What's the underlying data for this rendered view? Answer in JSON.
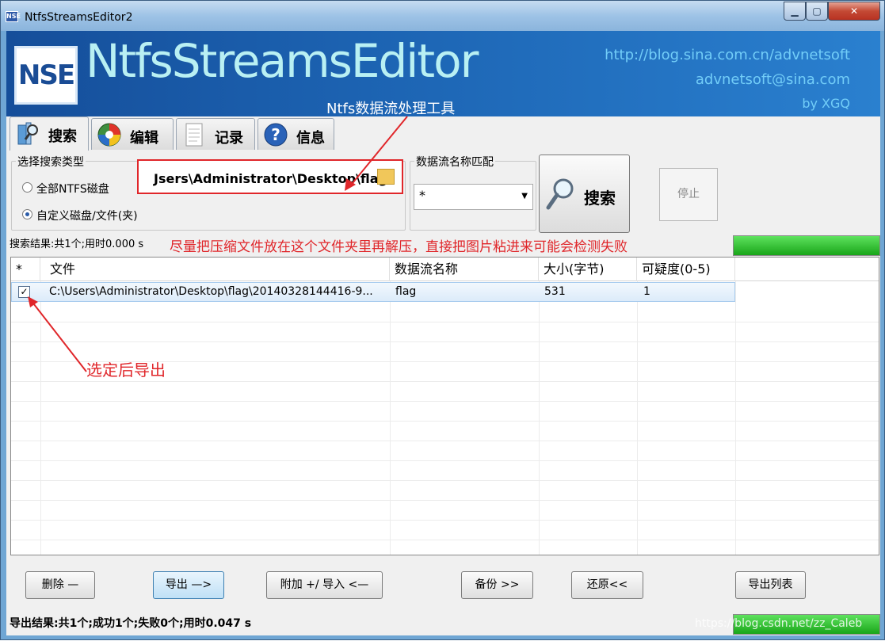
{
  "window": {
    "title": "NtfsStreamsEditor2",
    "app_icon": "NSE",
    "min": "▁",
    "max": "▢",
    "close": "✕"
  },
  "banner": {
    "logo": "NSE",
    "title": "NtfsStreamsEditor",
    "subtitle": "Ntfs数据流处理工具",
    "url": "http://blog.sina.com.cn/advnetsoft",
    "email": "advnetsoft@sina.com",
    "author": "by XGQ"
  },
  "tabs": [
    {
      "label": "搜索",
      "icon": "search-folder-icon"
    },
    {
      "label": "编辑",
      "icon": "edit-icon"
    },
    {
      "label": "记录",
      "icon": "document-icon"
    },
    {
      "label": "信息",
      "icon": "help-icon"
    }
  ],
  "search": {
    "type_group_label": "选择搜索类型",
    "radio_all": "全部NTFS磁盘",
    "radio_custom": "自定义磁盘/文件(夹)",
    "path_value": "Jsers\\Administrator\\Desktop\\flag",
    "match_group_label": "数据流名称匹配",
    "match_value": "*",
    "search_button": "搜索",
    "stop_button": "停止",
    "result": "搜索结果:共1个;用时0.000 s"
  },
  "annotations": {
    "hint_top": "尽量把压缩文件放在这个文件夹里再解压，直接把图片粘进来可能会检测失败",
    "hint_select": "选定后导出"
  },
  "table": {
    "headers": [
      "*",
      "文件",
      "数据流名称",
      "大小(字节)",
      "可疑度(0-5)"
    ],
    "rows": [
      {
        "checked": "✓",
        "file": "C:\\Users\\Administrator\\Desktop\\flag\\20140328144416-9...",
        "stream": "flag",
        "size": "531",
        "suspicion": "1"
      }
    ]
  },
  "buttons": {
    "delete": "删除 —",
    "export": "导出 —>",
    "append_import": "附加 +/ 导入 <—",
    "backup": "备份  >>",
    "restore": "还原<<",
    "export_list": "导出列表"
  },
  "status": {
    "export_result": "导出结果:共1个;成功1个;失败0个;用时0.047 s",
    "watermark": "https://blog.csdn.net/zz_Caleb"
  },
  "colors": {
    "annotation_red": "#e0262a",
    "banner_blue": "#1d65b4",
    "progress_green": "#19a519"
  }
}
